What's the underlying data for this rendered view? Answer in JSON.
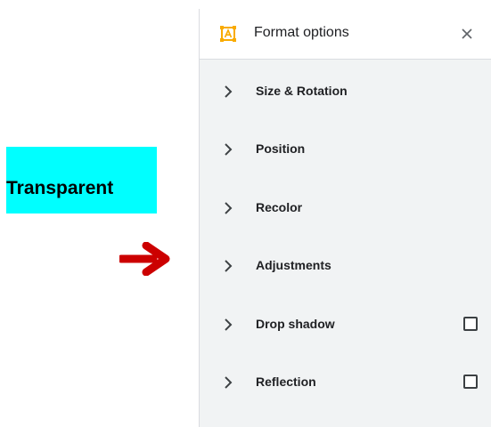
{
  "annotation": {
    "label": "Transparent",
    "label_background": "#00ffff",
    "arrow_color": "#cc0000",
    "arrow_icon": "right-arrow-icon"
  },
  "panel": {
    "title": "Format options",
    "title_icon": "format-options-icon",
    "close_icon": "close-icon",
    "sections": [
      {
        "label": "Size & Rotation",
        "icon": "chevron-right-icon",
        "has_checkbox": false
      },
      {
        "label": "Position",
        "icon": "chevron-right-icon",
        "has_checkbox": false
      },
      {
        "label": "Recolor",
        "icon": "chevron-right-icon",
        "has_checkbox": false
      },
      {
        "label": "Adjustments",
        "icon": "chevron-right-icon",
        "has_checkbox": false
      },
      {
        "label": "Drop shadow",
        "icon": "chevron-right-icon",
        "has_checkbox": true,
        "checked": false
      },
      {
        "label": "Reflection",
        "icon": "chevron-right-icon",
        "has_checkbox": true,
        "checked": false
      }
    ]
  },
  "colors": {
    "panel_bg": "#f1f3f4",
    "header_bg": "#ffffff",
    "accent_orange": "#f9ab00",
    "text": "#202124"
  }
}
